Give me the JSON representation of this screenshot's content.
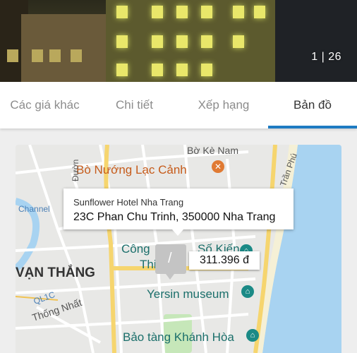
{
  "hero": {
    "counter": "1 | 26"
  },
  "tabs": [
    {
      "label": "Các giá khác"
    },
    {
      "label": "Chi tiết"
    },
    {
      "label": "Xếp hạng"
    },
    {
      "label": "Bản đồ",
      "active": true
    }
  ],
  "map": {
    "callout": {
      "hotel_name": "Sunflower Hotel Nha Trang",
      "address": "23C Phan Chu Trinh, 350000 Nha Trang"
    },
    "price": "311.396 đ",
    "labels": {
      "bo_ke_nam": "Bờ Kè Nam",
      "bo_nuong": "Bò Nướng Lạc Cảnh",
      "duong": "Đườn",
      "tran_phu": "Trần Phú",
      "channel": "Channel",
      "cong_vien": "Công",
      "thi": "Thi",
      "so_kien": "Số Kiến",
      "van_thang": "VẠN THẮNG",
      "ql1c": "QL1C",
      "yersin": "Yersin museum",
      "thong_nhat": "Thống Nhất",
      "bao_tang": "Bảo tàng Khánh Hòa"
    },
    "colors": {
      "water": "#a8d3f1",
      "road_major": "#f6d56e",
      "land": "#e8e8e6",
      "park": "#c6e7b9",
      "accent": "#1e7bc2"
    }
  }
}
